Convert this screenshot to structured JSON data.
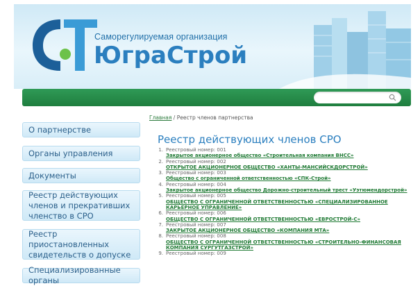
{
  "header": {
    "org_subtitle": "Саморегулируемая организация",
    "org_name": "ЮграСтрой",
    "icons": [
      "home-icon",
      "mail-icon",
      "sitemap-icon"
    ]
  },
  "search": {
    "value": "",
    "placeholder": ""
  },
  "sidebar": {
    "items": [
      {
        "label": "О партнерстве"
      },
      {
        "label": "Органы управления"
      },
      {
        "label": "Документы"
      },
      {
        "label": "Реестр действующих членов и прекративших членство в СРО"
      },
      {
        "label": "Реестр приостановленных свидетельств о допуске"
      },
      {
        "label": "Специализированные органы"
      }
    ]
  },
  "breadcrumb": {
    "home": "Главная",
    "separator": " / ",
    "current": "Реестр членов партнерства"
  },
  "page_title": "Реестр действующих членов СРО",
  "registry": {
    "label": "Реестровый номер:",
    "items": [
      {
        "n": "1.",
        "num": "001",
        "name": "Закрытое акционерное общество «Строительная компания ВНСС»"
      },
      {
        "n": "2.",
        "num": "002",
        "name": "ОТКРЫТОЕ АКЦИОНЕРНОЕ ОБЩЕСТВО «ХАНТЫ-МАНСИЙСКДОРСТРОЙ»"
      },
      {
        "n": "3.",
        "num": "003",
        "name": "Общество с ограниченной ответственностью «СПК-Строй»"
      },
      {
        "n": "4.",
        "num": "004",
        "name": "Закрытое акционерное общество Дорожно-строительный трест «Уэтюмендорстрой»"
      },
      {
        "n": "5.",
        "num": "005",
        "name": "ОБЩЕСТВО С ОГРАНИЧЕННОЙ ОТВЕТСТВЕННОСТЬЮ «СПЕЦИАЛИЗИРОВАННОЕ КАРЬЕРНОЕ УПРАВЛЕНИЕ»"
      },
      {
        "n": "6.",
        "num": "006",
        "name": "ОБЩЕСТВО С ОГРАНИЧЕННОЙ ОТВЕТСТВЕННОСТЬЮ «ЕВРОСТРОЙ-С»"
      },
      {
        "n": "7.",
        "num": "007",
        "name": "ЗАКРЫТОЕ АКЦИОНЕРНОЕ ОБЩЕСТВО «КОМПАНИЯ МТА»"
      },
      {
        "n": "8.",
        "num": "008",
        "name": "ОБЩЕСТВО С ОГРАНИЧЕННОЙ ОТВЕТСТВЕННОСТЬЮ «СТРОИТЕЛЬНО-ФИНАНСОВАЯ КОМПАНИЯ СУРГУТГАЗСТРОЙ»"
      },
      {
        "n": "9.",
        "num": "009",
        "name": ""
      }
    ]
  }
}
